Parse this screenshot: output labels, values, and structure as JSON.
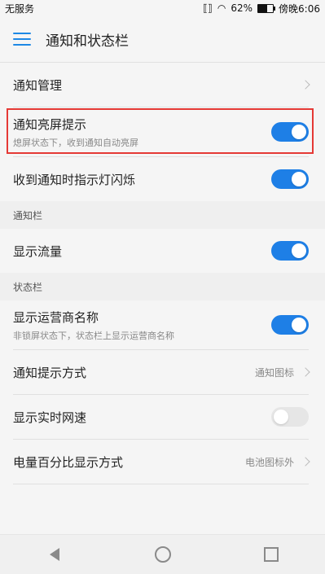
{
  "statusbar": {
    "left": "无服务",
    "battery_pct": "62%",
    "time": "傍晚6:06"
  },
  "appbar": {
    "title": "通知和状态栏"
  },
  "rows": [
    {
      "id": "notify_manage",
      "title": "通知管理"
    },
    {
      "id": "wake_screen",
      "title": "通知亮屏提示",
      "subtitle": "熄屏状态下，收到通知自动亮屏",
      "toggle": true
    },
    {
      "id": "indicator_light",
      "title": "收到通知时指示灯闪烁",
      "toggle": true
    }
  ],
  "sections": {
    "notifications_bar": {
      "label": "通知栏",
      "rows": [
        {
          "id": "show_traffic",
          "title": "显示流量",
          "toggle": true
        }
      ]
    },
    "status_bar": {
      "label": "状态栏",
      "rows": [
        {
          "id": "carrier_name",
          "title": "显示运营商名称",
          "subtitle": "非锁屏状态下，状态栏上显示运营商名称",
          "toggle": true
        },
        {
          "id": "notify_style",
          "title": "通知提示方式",
          "value": "通知图标"
        },
        {
          "id": "realtime_speed",
          "title": "显示实时网速",
          "toggle": false
        },
        {
          "id": "battery_percent",
          "title": "电量百分比显示方式",
          "value": "电池图标外"
        }
      ]
    }
  },
  "colors": {
    "accent": "#1e7fe6",
    "highlight": "#e53935"
  }
}
